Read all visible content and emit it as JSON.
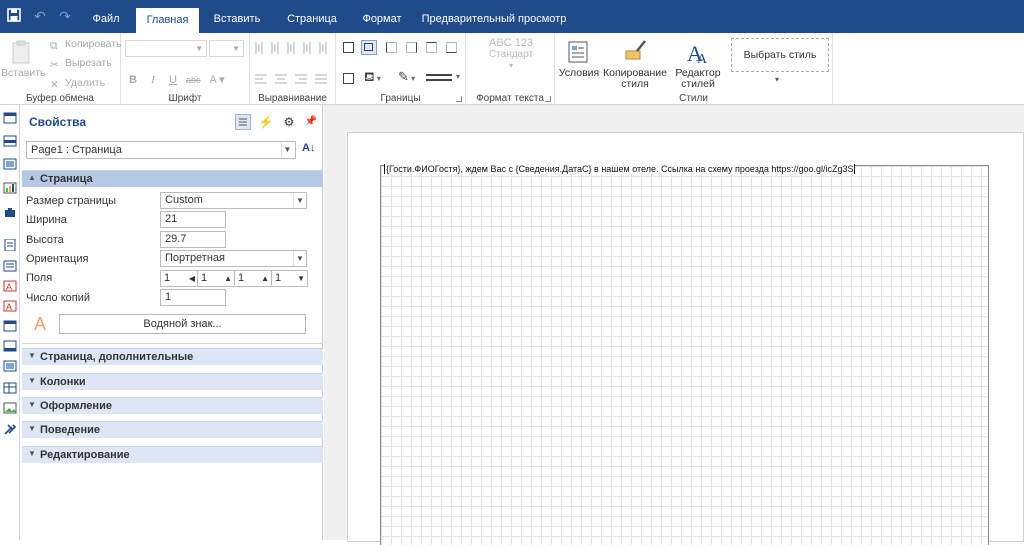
{
  "quick_access": [
    "save-icon",
    "undo-icon",
    "redo-icon"
  ],
  "tabs": [
    {
      "label": "Файл",
      "active": false
    },
    {
      "label": "Главная",
      "active": true
    },
    {
      "label": "Вставить",
      "active": false
    },
    {
      "label": "Страница",
      "active": false
    },
    {
      "label": "Формат",
      "active": false
    },
    {
      "label": "Предварительный просмотр",
      "active": false
    }
  ],
  "ribbon": {
    "clipboard": {
      "paste_label": "Вставить",
      "copy_label": "Копировать",
      "cut_label": "Вырезать",
      "delete_label": "Удалить",
      "group_label": "Буфер обмена"
    },
    "font": {
      "group_label": "Шрифт"
    },
    "alignment": {
      "group_label": "Выравнивание"
    },
    "borders": {
      "group_label": "Границы"
    },
    "text_format": {
      "standard_label": "Стандарт",
      "sample": "ABC 123",
      "group_label": "Формат текста"
    },
    "styles": {
      "conditions_label": "Условия",
      "copy_style_label": "Копирование стиля",
      "style_editor_label": "Редактор стилей",
      "choose_style_label": "Выбрать стиль",
      "group_label": "Стили"
    }
  },
  "panel": {
    "title": "Свойства",
    "object_selector": "Page1 : Страница",
    "sections": [
      {
        "label": "Страница",
        "open": true
      },
      {
        "label": "Страница, дополнительные",
        "open": false
      },
      {
        "label": "Колонки",
        "open": false
      },
      {
        "label": "Оформление",
        "open": false
      },
      {
        "label": "Поведение",
        "open": false
      },
      {
        "label": "Редактирование",
        "open": false
      }
    ],
    "props": {
      "page_size_label": "Размер страницы",
      "page_size_value": "Custom",
      "width_label": "Ширина",
      "width_value": "21",
      "height_label": "Высота",
      "height_value": "29.7",
      "orientation_label": "Ориентация",
      "orientation_value": "Портретная",
      "margins_label": "Поля",
      "margins": [
        "1",
        "1",
        "1",
        "1"
      ],
      "copies_label": "Число копий",
      "copies_value": "1",
      "watermark_button": "Водяной знак..."
    }
  },
  "designer": {
    "textbox_text": "{Гости.ФИОГостя}, ждем Вас с {Сведения.ДатаС} в нашем отеле. Ссылка на схему проезда https://goo.gl/icZg3S"
  },
  "colors": {
    "accent": "#1f4b8b",
    "section_bg": "#dce6f4"
  }
}
